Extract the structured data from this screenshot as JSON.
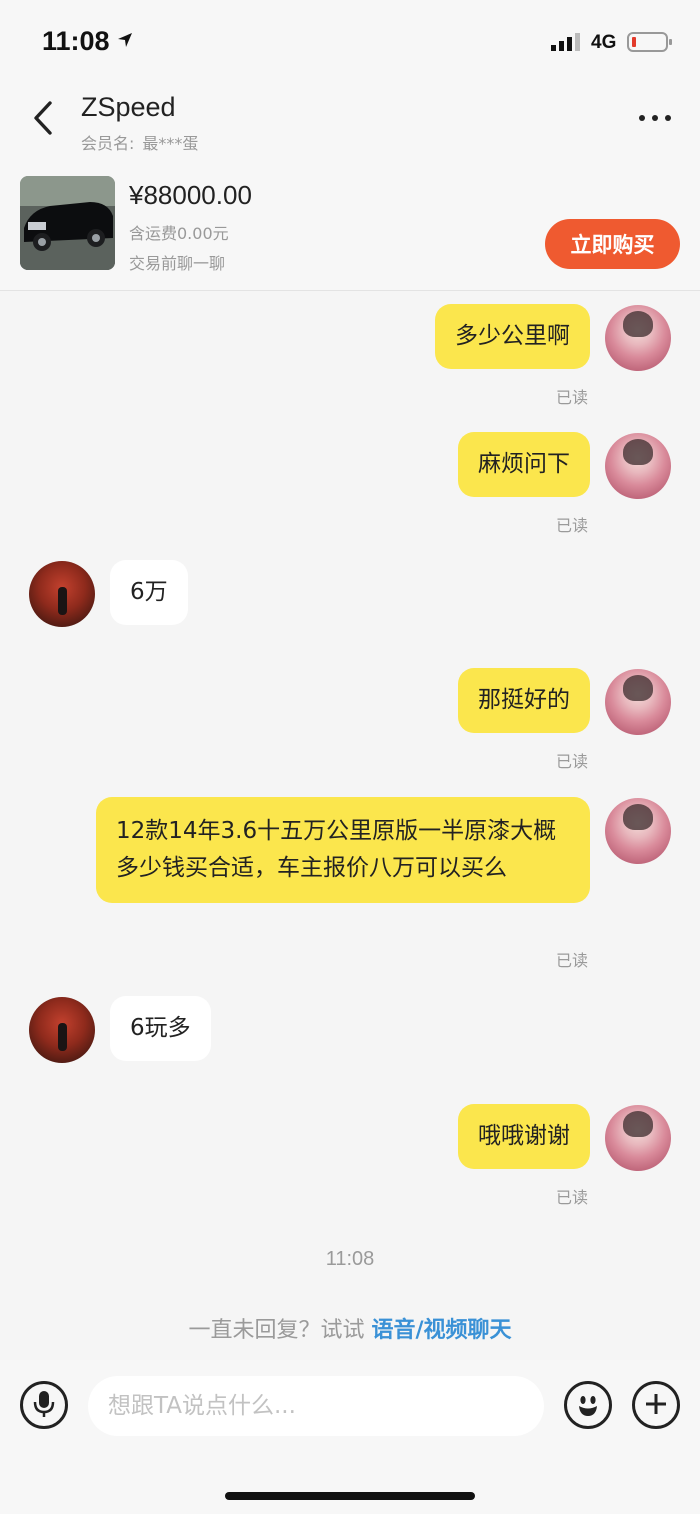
{
  "status_bar": {
    "time": "11:08",
    "network": "4G"
  },
  "header": {
    "title": "ZSpeed",
    "member_label": "会员名:",
    "member_name": "最***蛋"
  },
  "product": {
    "price": "¥88000.00",
    "shipping": "含运费0.00元",
    "hint": "交易前聊一聊",
    "buy_label": "立即购买"
  },
  "messages": [
    {
      "from": "me",
      "text": "多少公里啊",
      "status": "已读"
    },
    {
      "from": "me",
      "text": "麻烦问下",
      "status": "已读"
    },
    {
      "from": "peer",
      "text": "6万"
    },
    {
      "from": "me",
      "text": "那挺好的",
      "status": "已读"
    },
    {
      "from": "me",
      "text": "12款14年3.6十五万公里原版一半原漆大概多少钱买合适，车主报价八万可以买么",
      "status": "已读"
    },
    {
      "from": "peer",
      "text": "6玩多"
    },
    {
      "from": "me",
      "text": "哦哦谢谢",
      "status": "已读"
    }
  ],
  "time_divider": "11:08",
  "call_suggestion": {
    "prefix": "一直未回复？试试 ",
    "link": "语音/视频聊天"
  },
  "input": {
    "placeholder": "想跟TA说点什么..."
  },
  "icons": {
    "location": "location-arrow-icon",
    "signal": "signal-bars-icon",
    "battery": "battery-icon",
    "back": "chevron-left-icon",
    "more": "more-dots-icon",
    "voice": "microphone-icon",
    "emoji": "smiley-icon",
    "add": "plus-icon"
  },
  "colors": {
    "my_bubble": "#fbe64d",
    "peer_bubble": "#ffffff",
    "buy_button": "#ef5a30",
    "call_link": "#3a91d6",
    "battery_level": "#e23b2b"
  }
}
